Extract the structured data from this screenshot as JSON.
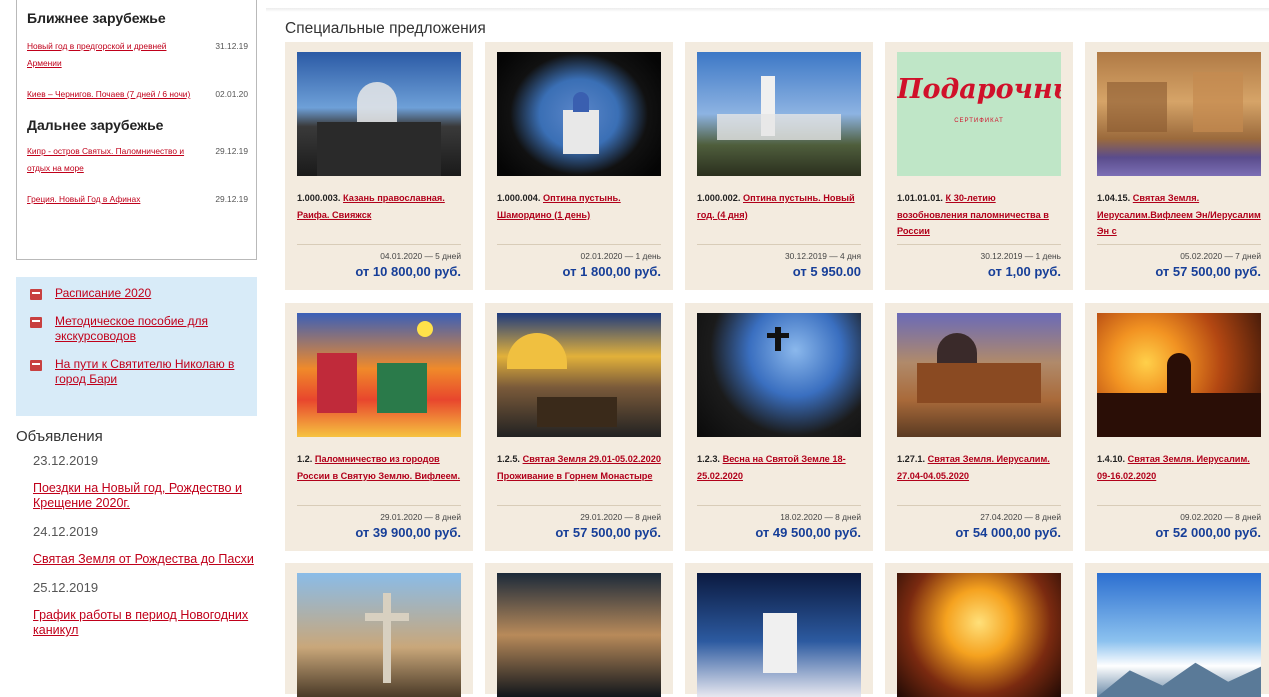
{
  "sidebar": {
    "near_abroad_title": "Ближнее зарубежье",
    "near_abroad_items": [
      {
        "title": "Новый год в предгорской и древней Армении",
        "date": "31.12.19"
      },
      {
        "title": "Киев – Чернигов. Почаев (7 дней / 6 ночи)",
        "date": "02.01.20"
      }
    ],
    "far_abroad_title": "Дальнее зарубежье",
    "far_abroad_items": [
      {
        "title": "Кипр - остров Святых. Паломничество и отдых на море",
        "date": "29.12.19"
      },
      {
        "title": "Греция. Новый Год в Афинах",
        "date": "29.12.19"
      }
    ],
    "doc_links": [
      {
        "label": "Расписание 2020"
      },
      {
        "label": "Методическое пособие для экскурсоводов"
      },
      {
        "label": "На пути к Святителю Николаю в город Бари"
      }
    ],
    "announcements_title": "Объявления",
    "announcements": [
      {
        "date": "23.12.2019",
        "title": "Поездки на Новый год, Рождество и Крещение 2020г."
      },
      {
        "date": "24.12.2019",
        "title": "Святая Земля от Рождества до Пасхи"
      },
      {
        "date": "25.12.2019",
        "title": "График работы в период Новогодних каникул"
      }
    ]
  },
  "main": {
    "title": "Специальные предложения",
    "certificate_text": "Подарочный",
    "certificate_sub": "СЕРТИФИКАТ",
    "offers": [
      {
        "code": "1.000.003.",
        "title": "Казань православная. Раифа. Свияжск",
        "dates": "04.01.2020 — 5 дней",
        "price": "от 10 800,00 руб."
      },
      {
        "code": "1.000.004.",
        "title": "Оптина пустынь. Шамордино (1 день)",
        "dates": "02.01.2020 — 1 день",
        "price": "от 1 800,00 руб."
      },
      {
        "code": "1.000.002.",
        "title": "Оптина пустынь. Новый год. (4 дня)",
        "dates": "30.12.2019 — 4 дня",
        "price": "от 5 950.00"
      },
      {
        "code": "1.01.01.01.",
        "title": "К 30-летию возобновления паломничества в России",
        "dates": "30.12.2019 — 1 день",
        "price": "от 1,00 руб."
      },
      {
        "code": "1.04.15.",
        "title": "Святая Земля. Иерусалим.Вифлеем Эн/Иерусалим Эн с",
        "dates": "05.02.2020 — 7 дней",
        "price": "от 57 500,00 руб."
      },
      {
        "code": "1.2.",
        "title": "Паломничество из городов России в Святую Землю. Вифлеем.",
        "dates": "29.01.2020 — 8 дней",
        "price": "от 39 900,00 руб."
      },
      {
        "code": "1.2.5.",
        "title": "Святая Земля 29.01-05.02.2020 Проживание в Горнем Монастыре",
        "dates": "29.01.2020 — 8 дней",
        "price": "от 57 500,00 руб."
      },
      {
        "code": "1.2.3.",
        "title": "Весна на Святой Земле 18-25.02.2020",
        "dates": "18.02.2020 — 8 дней",
        "price": "от 49 500,00 руб."
      },
      {
        "code": "1.27.1.",
        "title": "Святая Земля. Иерусалим. 27.04-04.05.2020",
        "dates": "27.04.2020 — 8 дней",
        "price": "от 54 000,00 руб."
      },
      {
        "code": "1.4.10.",
        "title": "Святая Земля. Иерусалим. 09-16.02.2020",
        "dates": "09.02.2020 — 8 дней",
        "price": "от 52 000,00 руб."
      }
    ]
  }
}
